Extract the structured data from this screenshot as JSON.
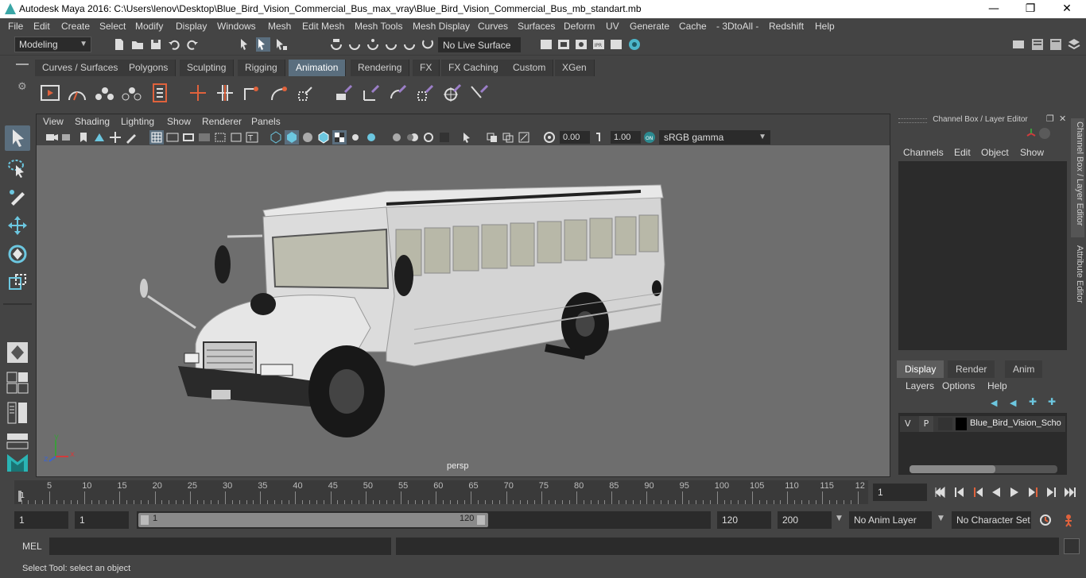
{
  "window": {
    "title": "Autodesk Maya 2016: C:\\Users\\lenov\\Desktop\\Blue_Bird_Vision_Commercial_Bus_max_vray\\Blue_Bird_Vision_Commercial_Bus_mb_standart.mb",
    "minimize": "—",
    "restore": "❐",
    "close": "✕"
  },
  "menubar": [
    "File",
    "Edit",
    "Create",
    "Select",
    "Modify",
    "Display",
    "Windows",
    "Mesh",
    "Edit Mesh",
    "Mesh Tools",
    "Mesh Display",
    "Curves",
    "Surfaces",
    "Deform",
    "UV",
    "Generate",
    "Cache",
    "- 3DtoAll -",
    "Redshift",
    "Help"
  ],
  "statusline": {
    "mode": "Modeling",
    "live_surface": "No Live Surface"
  },
  "shelf_tabs": [
    "Curves / Surfaces",
    "Polygons",
    "Sculpting",
    "Rigging",
    "Animation",
    "Rendering",
    "FX",
    "FX Caching",
    "Custom",
    "XGen"
  ],
  "shelf_active": "Animation",
  "viewport": {
    "menu": [
      "View",
      "Shading",
      "Lighting",
      "Show",
      "Renderer",
      "Panels"
    ],
    "exposure": "0.00",
    "gamma": "1.00",
    "color_space": "sRGB gamma",
    "camera_label": "persp",
    "axis_x": "x",
    "axis_y": "y",
    "axis_z": "z"
  },
  "channel_box": {
    "title": "Channel Box / Layer Editor",
    "menu": [
      "Channels",
      "Edit",
      "Object",
      "Show"
    ],
    "layer_tabs": [
      "Display",
      "Render",
      "Anim"
    ],
    "layer_menu": [
      "Layers",
      "Options",
      "Help"
    ],
    "layer": {
      "v": "V",
      "p": "P",
      "name": "Blue_Bird_Vision_Scho"
    },
    "side_tabs": [
      "Channel Box / Layer Editor",
      "Attribute Editor"
    ]
  },
  "timeslider": {
    "ticks": [
      5,
      10,
      15,
      20,
      25,
      30,
      35,
      40,
      45,
      50,
      55,
      60,
      65,
      70,
      75,
      80,
      85,
      90,
      95,
      100,
      105,
      110,
      115,
      12
    ],
    "current_frame_marker": "1",
    "current_frame": "1"
  },
  "rangeslider": {
    "start": "1",
    "playback_start": "1",
    "range_start_label": "1",
    "range_end_label": "120",
    "playback_end": "120",
    "end": "200",
    "anim_layer": "No Anim Layer",
    "character_set": "No Character Set"
  },
  "command_line": {
    "label": "MEL"
  },
  "help_line": {
    "text": "Select Tool: select an object"
  },
  "colors": {
    "active_tab": "#5a6e7e",
    "background": "#444444",
    "viewport": "#6e6e6e"
  }
}
